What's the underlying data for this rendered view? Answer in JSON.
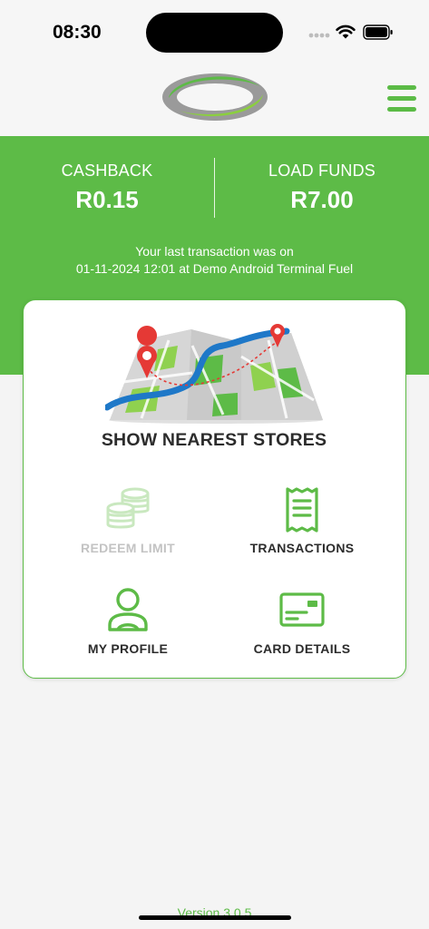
{
  "status_bar": {
    "time": "08:30",
    "icons": [
      "cellular-signal-icon",
      "wifi-icon",
      "battery-icon"
    ]
  },
  "header": {
    "logo": "brand-logo",
    "menu_icon": "hamburger-menu-icon"
  },
  "balances": {
    "cashback": {
      "label": "CASHBACK",
      "value": "R0.15"
    },
    "load_funds": {
      "label": "LOAD FUNDS",
      "value": "R7.00"
    }
  },
  "last_transaction": {
    "line1": "Your last transaction was on",
    "line2": "01-11-2024 12:01 at Demo Android Terminal Fuel"
  },
  "actions": {
    "nearest_stores": {
      "label": "SHOW NEAREST STORES",
      "icon": "map-illustration"
    },
    "redeem_limit": {
      "label": "REDEEM LIMIT",
      "icon": "coins-icon",
      "disabled": true
    },
    "transactions": {
      "label": "TRANSACTIONS",
      "icon": "receipt-icon"
    },
    "my_profile": {
      "label": "MY PROFILE",
      "icon": "user-icon"
    },
    "card_details": {
      "label": "CARD DETAILS",
      "icon": "card-icon"
    }
  },
  "footer": {
    "version": "Version 3.0.5"
  },
  "colors": {
    "brand_green": "#5dbb47",
    "disabled_gray": "#c3c3c3",
    "text_dark": "#2c2c2c"
  }
}
